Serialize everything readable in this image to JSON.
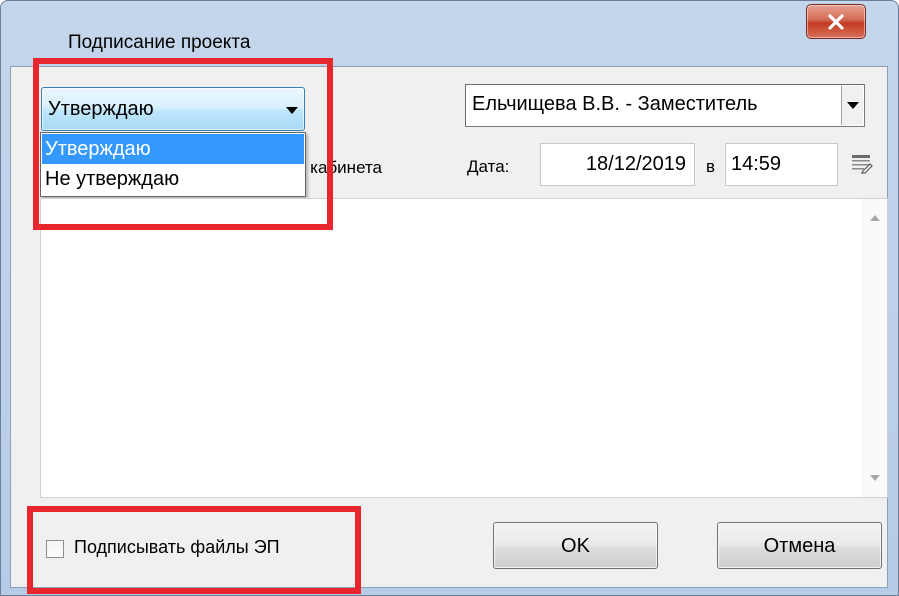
{
  "window": {
    "title": "Подписание проекта"
  },
  "resolution": {
    "selected": "Утверждаю",
    "options": [
      "Утверждаю",
      "Не утверждаю"
    ]
  },
  "hidden_label_fragment": "е кабинета",
  "signer": {
    "value": "Ельчищева В.В. - Заместитель"
  },
  "date": {
    "label": "Дата:",
    "value": "18/12/2019",
    "time_prefix": "в",
    "time": "14:59"
  },
  "sign_files": {
    "label": "Подписывать файлы ЭП",
    "checked": false
  },
  "buttons": {
    "ok": "OK",
    "cancel": "Отмена"
  },
  "colors": {
    "highlight": "#e8262e",
    "selection": "#3399ff",
    "close": "#c43b22"
  }
}
